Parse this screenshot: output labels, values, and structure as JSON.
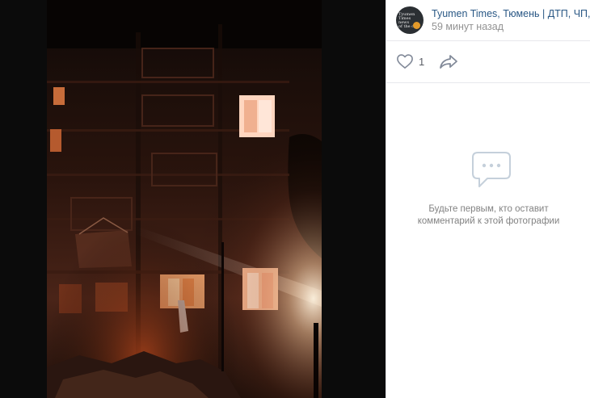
{
  "post": {
    "author": "Tyumen Times, Тюмень | ДТП, ЧП, ЧС",
    "time": "59 минут назад",
    "avatar_lines": [
      "Tyumen Times",
      "news",
      "of the city"
    ]
  },
  "actions": {
    "like_count": "1"
  },
  "comments": {
    "empty_line1": "Будьте первым, кто оставит",
    "empty_line2": "комментарий к этой фотографии"
  },
  "photo": {
    "description": "night photo of damaged apartment building"
  },
  "colors": {
    "link": "#2a5885",
    "muted": "#939393",
    "icon": "#99a2ad",
    "empty_icon": "#c5d0db",
    "divider": "#e7e8ec"
  },
  "icons": {
    "like": "heart-icon",
    "share": "share-arrow-icon",
    "empty": "comment-bubble-icon"
  }
}
